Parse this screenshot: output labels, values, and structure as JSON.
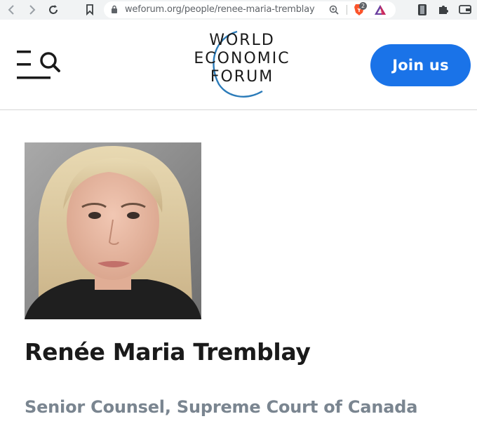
{
  "browser": {
    "url": "weforum.org/people/renee-maria-tremblay",
    "extension_badge": "2",
    "icons": [
      "back-icon",
      "forward-icon",
      "reload-icon",
      "bookmark-icon",
      "lock-icon",
      "zoom-icon",
      "brave-shields-icon",
      "brave-rewards-icon",
      "extension-icon",
      "puzzle-icon",
      "wallet-icon"
    ]
  },
  "header": {
    "logo_lines": [
      "WORLD",
      "ECONOMIC",
      "FORUM"
    ],
    "join_label": "Join us",
    "accent_color": "#1a73e8"
  },
  "profile": {
    "name": "Renée Maria Tremblay",
    "title": "Senior Counsel, Supreme Court of Canada"
  }
}
